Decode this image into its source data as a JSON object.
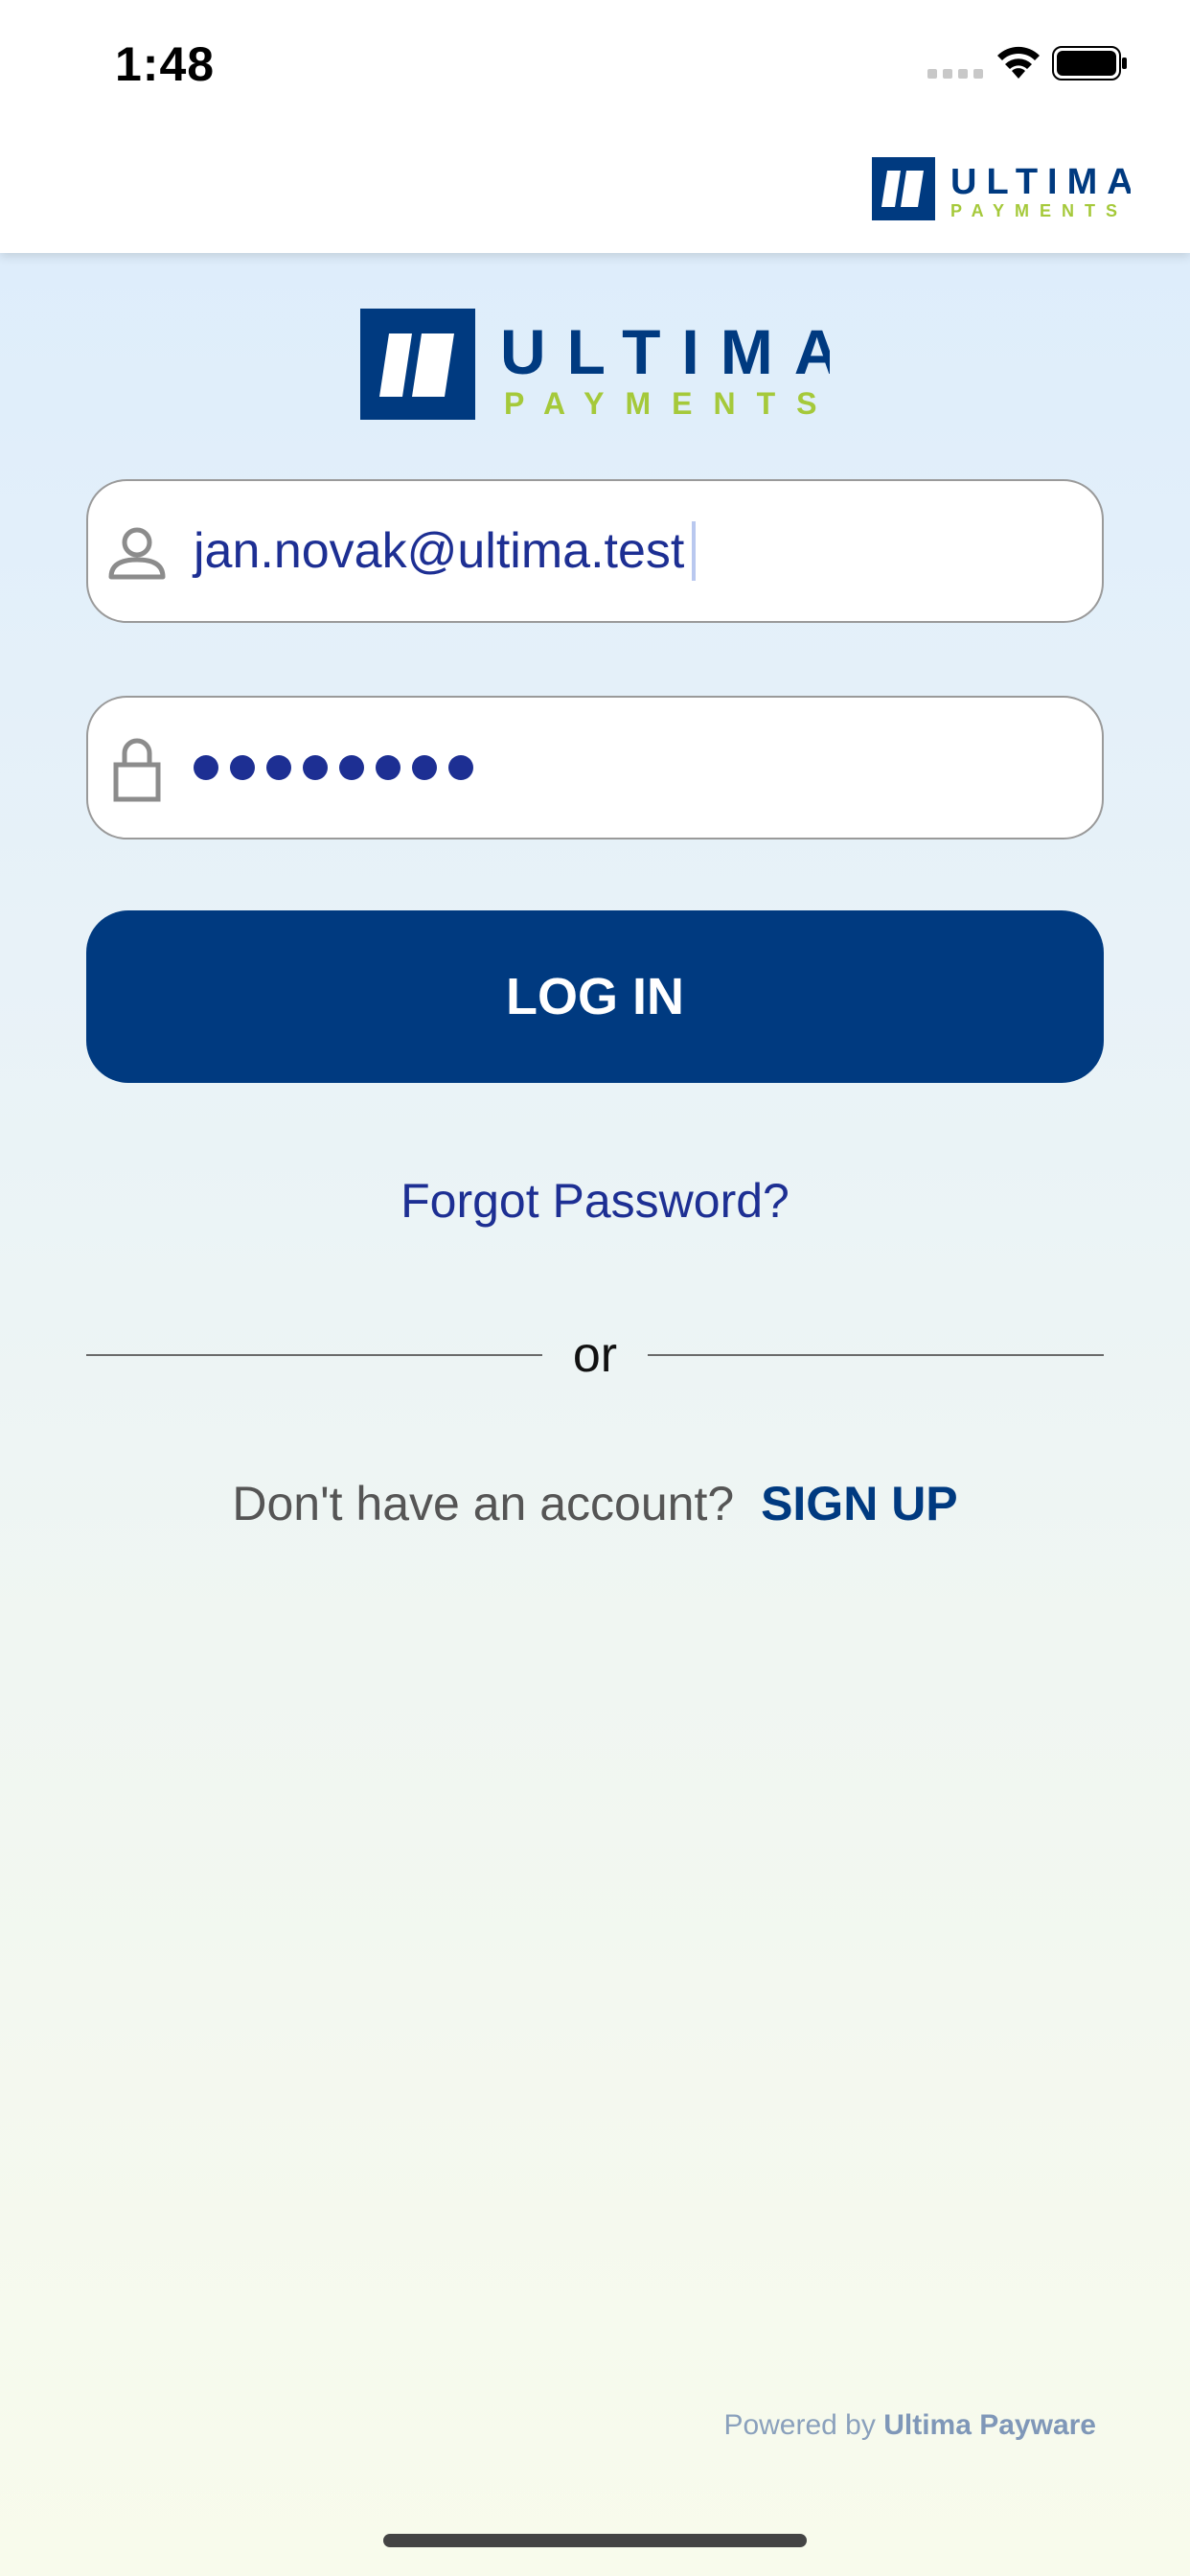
{
  "status_bar": {
    "time": "1:48"
  },
  "header": {
    "logo": {
      "word": "ULTIMA",
      "subword": "PAYMENTS",
      "icon": "ultima-logo-icon"
    }
  },
  "login": {
    "logo": {
      "word": "ULTIMA",
      "subword": "PAYMENTS"
    },
    "email": {
      "value": "jan.novak@ultima.test",
      "icon": "person-icon"
    },
    "password": {
      "masked_length": 8,
      "icon": "lock-icon"
    },
    "login_label": "LOG IN",
    "forgot_label": "Forgot Password?",
    "divider_label": "or",
    "signup_prompt": "Don't have an account?",
    "signup_label": "SIGN UP"
  },
  "footer": {
    "powered_prefix": "Powered by",
    "powered_brand": "Ultima Payware"
  },
  "colors": {
    "brand_blue": "#003a80",
    "brand_green": "#a5c93a",
    "link_blue": "#1d2f93"
  }
}
